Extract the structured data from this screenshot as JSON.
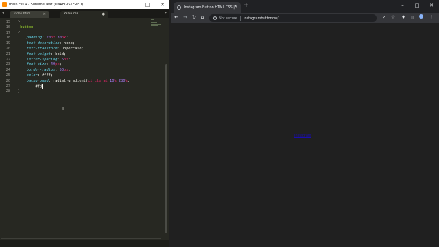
{
  "sublime": {
    "title": "main.css • - Sublime Text (UNREGISTERED)",
    "tabs": [
      {
        "label": "index.html"
      },
      {
        "label": "main.css"
      }
    ],
    "line_numbers": [
      "15",
      "16",
      "17",
      "18",
      "19",
      "20",
      "21",
      "22",
      "23",
      "24",
      "25",
      "26",
      "27",
      "28"
    ],
    "code": {
      "l15": "}",
      "l16": ".button",
      "l17": "{",
      "padding_prop": "padding",
      "padding_v1": "20",
      "padding_u1": "px",
      "padding_v2": "30",
      "padding_u2": "px",
      "textdec_prop": "text-decoration",
      "textdec_val": "none",
      "texttrans_prop": "text-transform",
      "texttrans_val": "uppercase",
      "fontweight_prop": "font-weight",
      "fontweight_val": "bold",
      "letterspacing_prop": "letter-spacing",
      "letterspacing_v": "5",
      "letterspacing_u": "px",
      "fontsize_prop": "font-size",
      "fontsize_v": "40",
      "fontsize_u": "px",
      "borderradius_prop": "border-radius",
      "borderradius_v": "50",
      "borderradius_u": "px",
      "color_prop": "color",
      "color_val": "#fff",
      "bg_prop": "background",
      "bg_fn": "radial-gradient",
      "bg_circle": "circle",
      "bg_at": "at",
      "bg_v1": "10",
      "bg_u1": "%",
      "bg_v2": "280",
      "bg_u2": "%",
      "l27": "#fd",
      "l28": "}"
    }
  },
  "chrome": {
    "tab_title": "Instagram Button HTML CSS | C",
    "not_secure": "Not secure",
    "url": "instagrambuttoncss/",
    "page_link": "Instagram"
  },
  "colors": {
    "editor_bg": "#272822",
    "chrome_bg": "#202124",
    "link": "#1a0dab"
  }
}
